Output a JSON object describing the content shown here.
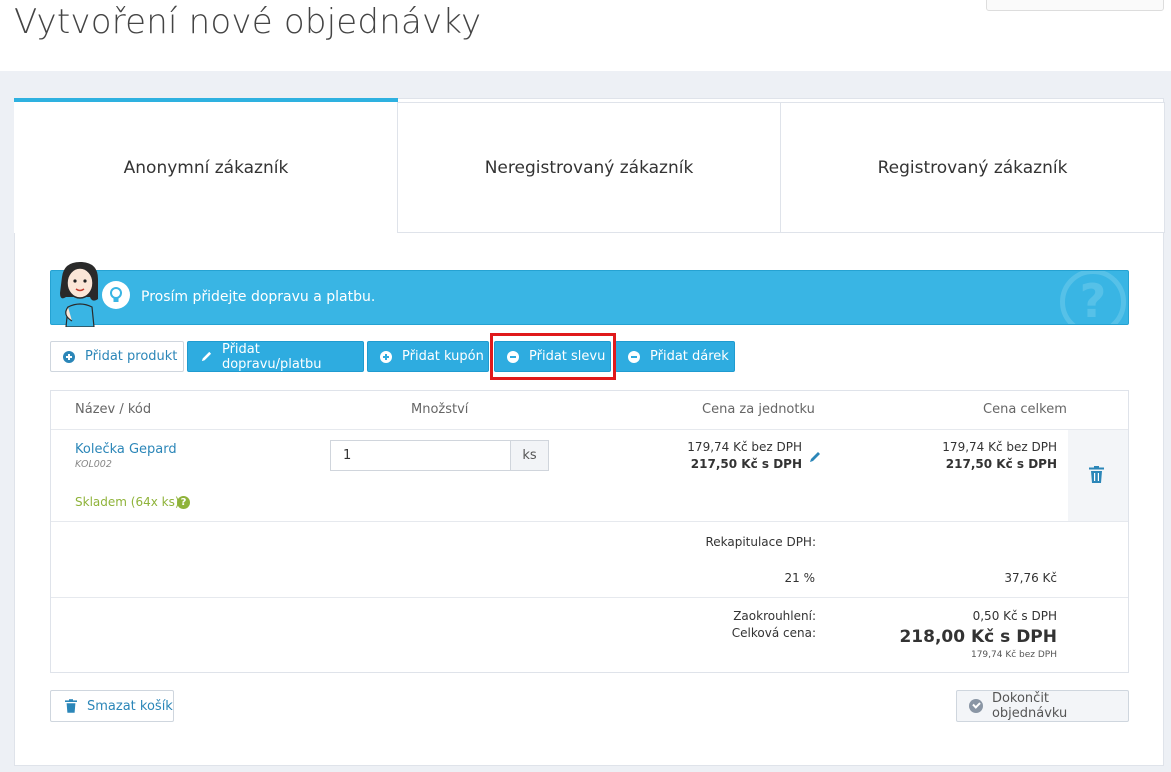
{
  "page": {
    "title": "Vytvoření nové objednávky"
  },
  "tabs": [
    {
      "label": "Anonymní zákazník",
      "active": true
    },
    {
      "label": "Neregistrovaný zákazník",
      "active": false
    },
    {
      "label": "Registrovaný zákazník",
      "active": false
    }
  ],
  "alert": {
    "message": "Prosím přidejte dopravu a platbu."
  },
  "toolbar": {
    "add_product": "Přidat produkt",
    "add_shipping": "Přidat dopravu/platbu",
    "add_coupon": "Přidat kupón",
    "add_discount": "Přidat slevu",
    "add_gift": "Přidat dárek"
  },
  "table": {
    "headers": {
      "name": "Název / kód",
      "qty": "Množství",
      "unit_price": "Cena za jednotku",
      "total": "Cena celkem"
    },
    "rows": [
      {
        "name": "Kolečka Gepard",
        "code": "KOL002",
        "stock": "Skladem (64x ks)",
        "qty": "1",
        "unit": "ks",
        "unit_price_net": "179,74 Kč bez DPH",
        "unit_price_gross": "217,50 Kč s DPH",
        "total_net": "179,74 Kč bez DPH",
        "total_gross": "217,50 Kč s DPH"
      }
    ]
  },
  "summary": {
    "vat_label": "Rekapitulace DPH:",
    "vat_rate": "21 %",
    "vat_amount": "37,76 Kč",
    "rounding_label": "Zaokrouhlení:",
    "rounding_value": "0,50 Kč s DPH",
    "total_label": "Celková cena:",
    "total_gross": "218,00 Kč s DPH",
    "total_net": "179,74 Kč bez DPH"
  },
  "footer": {
    "clear_cart": "Smazat košík",
    "finish_order": "Dokončit objednávku"
  },
  "colors": {
    "accent": "#2eace0",
    "highlight": "#e0191b",
    "stock": "#8fb33a"
  }
}
